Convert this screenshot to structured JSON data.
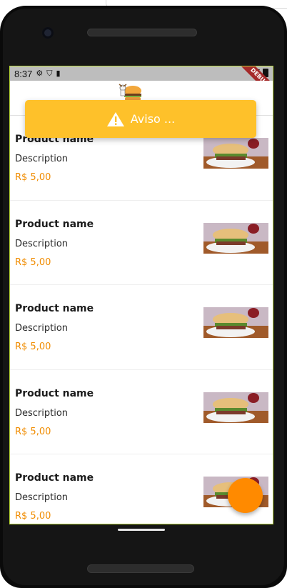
{
  "status_bar": {
    "time": "8:37",
    "debug_label": "DEBUG"
  },
  "toast": {
    "message": "Aviso ..."
  },
  "products": [
    {
      "name": "Product name",
      "description": "Description",
      "price": "R$ 5,00"
    },
    {
      "name": "Product name",
      "description": "Description",
      "price": "R$ 5,00"
    },
    {
      "name": "Product name",
      "description": "Description",
      "price": "R$ 5,00"
    },
    {
      "name": "Product name",
      "description": "Description",
      "price": "R$ 5,00"
    },
    {
      "name": "Product name",
      "description": "Description",
      "price": "R$ 5,00"
    }
  ],
  "colors": {
    "accent": "#ff8a00",
    "price": "#f08c00",
    "toast_bg": "#fec12a"
  },
  "icons": {
    "logo": "burger-logo-icon",
    "toast": "warning-icon",
    "fab": "add-icon"
  }
}
